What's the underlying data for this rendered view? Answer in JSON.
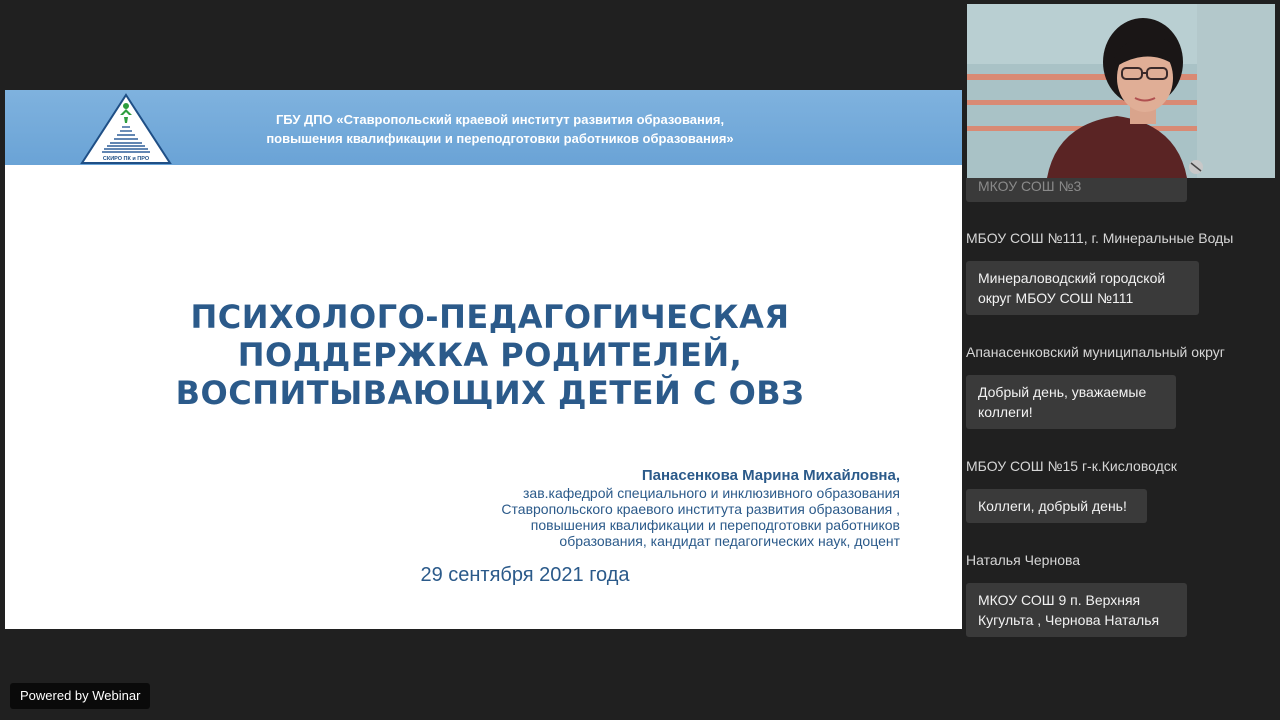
{
  "slide": {
    "logo_caption": "СКИРО ПК и ПРО",
    "header_line1": "ГБУ ДПО «Ставропольский краевой институт развития образования,",
    "header_line2": "повышения квалификации и переподготовки работников образования»",
    "title_line1": "ПСИХОЛОГО-ПЕДАГОГИЧЕСКАЯ",
    "title_line2": "ПОДДЕРЖКА РОДИТЕЛЕЙ,",
    "title_line3": "ВОСПИТЫВАЮЩИХ ДЕТЕЙ С ОВЗ",
    "author_name": "Панасенкова Марина Михайловна,",
    "author_role_lines": [
      "зав.кафедрой специального и инклюзивного образования",
      "Ставропольского краевого института развития образования ,",
      "повышения квалификации и переподготовки работников",
      "образования, кандидат педагогических наук, доцент"
    ],
    "date": "29 сентября 2021 года"
  },
  "chat": {
    "partial_top": "МКОУ СОШ №3",
    "messages": [
      {
        "author": "МБОУ СОШ №111, г. Минеральные Воды",
        "text_lines": [
          "Минераловодский городской",
          "округ МБОУ СОШ №111"
        ]
      },
      {
        "author": "Апанасенковский муниципальный округ",
        "text_lines": [
          "Добрый день, уважаемые",
          "коллеги!"
        ]
      },
      {
        "author": "МБОУ СОШ №15 г-к.Кисловодск",
        "text_lines": [
          "Коллеги, добрый день!"
        ]
      },
      {
        "author": "Наталья Чернова",
        "text_lines": [
          "МКОУ СОШ 9 п. Верхняя",
          "Кугульта , Чернова Наталья"
        ]
      }
    ]
  },
  "footer": {
    "powered_label": "Powered by Webinar"
  },
  "colors": {
    "background": "#202020",
    "slide_header": "#6aa3d6",
    "slide_text": "#2b5a8a",
    "chat_bubble": "#3a3a3a"
  }
}
